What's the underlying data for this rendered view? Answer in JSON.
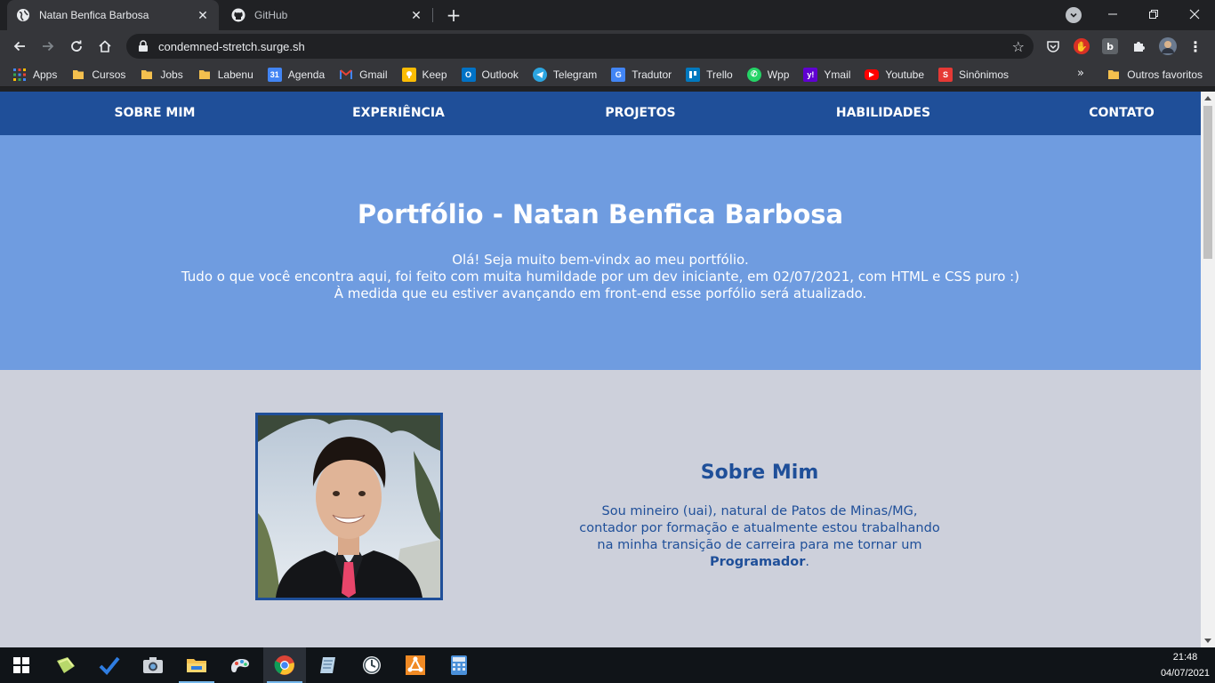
{
  "browser": {
    "tabs": [
      {
        "title": "Natan Benfica Barbosa",
        "active": true
      },
      {
        "title": "GitHub",
        "active": false
      }
    ],
    "url": "condemned-stretch.surge.sh",
    "bookmarks": [
      {
        "label": "Apps",
        "icon": "apps-grid-icon"
      },
      {
        "label": "Cursos",
        "icon": "folder-icon"
      },
      {
        "label": "Jobs",
        "icon": "folder-icon"
      },
      {
        "label": "Labenu",
        "icon": "folder-icon"
      },
      {
        "label": "Agenda",
        "icon": "calendar-icon"
      },
      {
        "label": "Gmail",
        "icon": "gmail-icon"
      },
      {
        "label": "Keep",
        "icon": "keep-icon"
      },
      {
        "label": "Outlook",
        "icon": "outlook-icon"
      },
      {
        "label": "Telegram",
        "icon": "telegram-icon"
      },
      {
        "label": "Tradutor",
        "icon": "translate-icon"
      },
      {
        "label": "Trello",
        "icon": "trello-icon"
      },
      {
        "label": "Wpp",
        "icon": "whatsapp-icon"
      },
      {
        "label": "Ymail",
        "icon": "yahoo-icon"
      },
      {
        "label": "Youtube",
        "icon": "youtube-icon"
      },
      {
        "label": "Sinônimos",
        "icon": "sinonimos-icon"
      }
    ],
    "other_bookmarks": "Outros favoritos"
  },
  "site": {
    "nav": [
      "SOBRE MIM",
      "EXPERIÊNCIA",
      "PROJETOS",
      "HABILIDADES",
      "CONTATO"
    ],
    "hero": {
      "title": "Portfólio - Natan Benfica Barbosa",
      "line1": "Olá! Seja muito bem-vindx ao meu portfólio.",
      "line2": "Tudo o que você encontra aqui, foi feito com muita humildade por um dev iniciante, em 02/07/2021, com HTML e CSS puro :)",
      "line3": "À medida que eu estiver avançando em front-end esse porfólio será atualizado."
    },
    "about": {
      "heading": "Sobre Mim",
      "bio_line1": "Sou mineiro (uai), natural de Patos de Minas/MG,",
      "bio_line2": "contador por formação e atualmente estou trabalhando",
      "bio_line3": "na minha transição de carreira para me tornar um",
      "bio_strong": "Programador",
      "bio_end": "."
    }
  },
  "taskbar": {
    "time": "21:48",
    "date": "04/07/2021"
  },
  "colors": {
    "nav_bg": "#1f4f99",
    "hero_bg": "#6f9ce0",
    "about_bg": "#cdd0db",
    "accent_text": "#1f4f99"
  }
}
